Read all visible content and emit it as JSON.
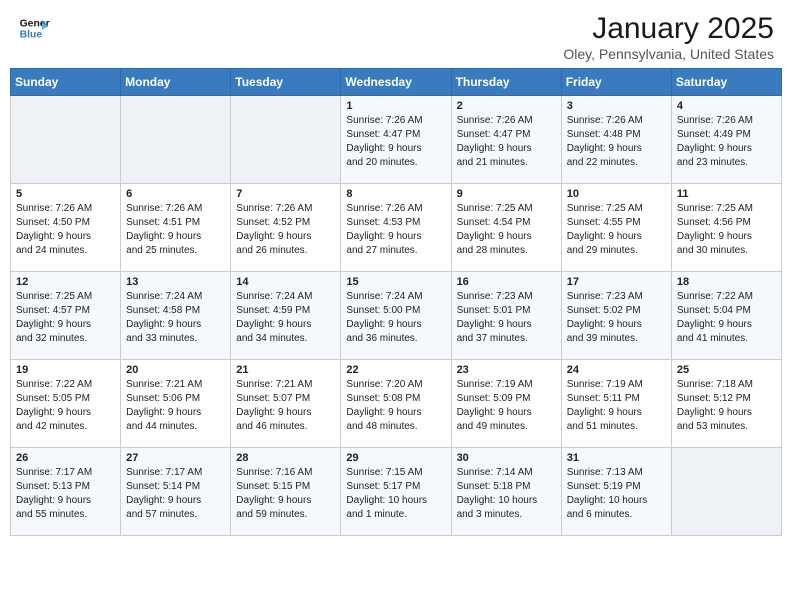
{
  "header": {
    "logo_line1": "General",
    "logo_line2": "Blue",
    "month": "January 2025",
    "location": "Oley, Pennsylvania, United States"
  },
  "weekdays": [
    "Sunday",
    "Monday",
    "Tuesday",
    "Wednesday",
    "Thursday",
    "Friday",
    "Saturday"
  ],
  "weeks": [
    [
      {
        "day": "",
        "info": ""
      },
      {
        "day": "",
        "info": ""
      },
      {
        "day": "",
        "info": ""
      },
      {
        "day": "1",
        "info": "Sunrise: 7:26 AM\nSunset: 4:47 PM\nDaylight: 9 hours\nand 20 minutes."
      },
      {
        "day": "2",
        "info": "Sunrise: 7:26 AM\nSunset: 4:47 PM\nDaylight: 9 hours\nand 21 minutes."
      },
      {
        "day": "3",
        "info": "Sunrise: 7:26 AM\nSunset: 4:48 PM\nDaylight: 9 hours\nand 22 minutes."
      },
      {
        "day": "4",
        "info": "Sunrise: 7:26 AM\nSunset: 4:49 PM\nDaylight: 9 hours\nand 23 minutes."
      }
    ],
    [
      {
        "day": "5",
        "info": "Sunrise: 7:26 AM\nSunset: 4:50 PM\nDaylight: 9 hours\nand 24 minutes."
      },
      {
        "day": "6",
        "info": "Sunrise: 7:26 AM\nSunset: 4:51 PM\nDaylight: 9 hours\nand 25 minutes."
      },
      {
        "day": "7",
        "info": "Sunrise: 7:26 AM\nSunset: 4:52 PM\nDaylight: 9 hours\nand 26 minutes."
      },
      {
        "day": "8",
        "info": "Sunrise: 7:26 AM\nSunset: 4:53 PM\nDaylight: 9 hours\nand 27 minutes."
      },
      {
        "day": "9",
        "info": "Sunrise: 7:25 AM\nSunset: 4:54 PM\nDaylight: 9 hours\nand 28 minutes."
      },
      {
        "day": "10",
        "info": "Sunrise: 7:25 AM\nSunset: 4:55 PM\nDaylight: 9 hours\nand 29 minutes."
      },
      {
        "day": "11",
        "info": "Sunrise: 7:25 AM\nSunset: 4:56 PM\nDaylight: 9 hours\nand 30 minutes."
      }
    ],
    [
      {
        "day": "12",
        "info": "Sunrise: 7:25 AM\nSunset: 4:57 PM\nDaylight: 9 hours\nand 32 minutes."
      },
      {
        "day": "13",
        "info": "Sunrise: 7:24 AM\nSunset: 4:58 PM\nDaylight: 9 hours\nand 33 minutes."
      },
      {
        "day": "14",
        "info": "Sunrise: 7:24 AM\nSunset: 4:59 PM\nDaylight: 9 hours\nand 34 minutes."
      },
      {
        "day": "15",
        "info": "Sunrise: 7:24 AM\nSunset: 5:00 PM\nDaylight: 9 hours\nand 36 minutes."
      },
      {
        "day": "16",
        "info": "Sunrise: 7:23 AM\nSunset: 5:01 PM\nDaylight: 9 hours\nand 37 minutes."
      },
      {
        "day": "17",
        "info": "Sunrise: 7:23 AM\nSunset: 5:02 PM\nDaylight: 9 hours\nand 39 minutes."
      },
      {
        "day": "18",
        "info": "Sunrise: 7:22 AM\nSunset: 5:04 PM\nDaylight: 9 hours\nand 41 minutes."
      }
    ],
    [
      {
        "day": "19",
        "info": "Sunrise: 7:22 AM\nSunset: 5:05 PM\nDaylight: 9 hours\nand 42 minutes."
      },
      {
        "day": "20",
        "info": "Sunrise: 7:21 AM\nSunset: 5:06 PM\nDaylight: 9 hours\nand 44 minutes."
      },
      {
        "day": "21",
        "info": "Sunrise: 7:21 AM\nSunset: 5:07 PM\nDaylight: 9 hours\nand 46 minutes."
      },
      {
        "day": "22",
        "info": "Sunrise: 7:20 AM\nSunset: 5:08 PM\nDaylight: 9 hours\nand 48 minutes."
      },
      {
        "day": "23",
        "info": "Sunrise: 7:19 AM\nSunset: 5:09 PM\nDaylight: 9 hours\nand 49 minutes."
      },
      {
        "day": "24",
        "info": "Sunrise: 7:19 AM\nSunset: 5:11 PM\nDaylight: 9 hours\nand 51 minutes."
      },
      {
        "day": "25",
        "info": "Sunrise: 7:18 AM\nSunset: 5:12 PM\nDaylight: 9 hours\nand 53 minutes."
      }
    ],
    [
      {
        "day": "26",
        "info": "Sunrise: 7:17 AM\nSunset: 5:13 PM\nDaylight: 9 hours\nand 55 minutes."
      },
      {
        "day": "27",
        "info": "Sunrise: 7:17 AM\nSunset: 5:14 PM\nDaylight: 9 hours\nand 57 minutes."
      },
      {
        "day": "28",
        "info": "Sunrise: 7:16 AM\nSunset: 5:15 PM\nDaylight: 9 hours\nand 59 minutes."
      },
      {
        "day": "29",
        "info": "Sunrise: 7:15 AM\nSunset: 5:17 PM\nDaylight: 10 hours\nand 1 minute."
      },
      {
        "day": "30",
        "info": "Sunrise: 7:14 AM\nSunset: 5:18 PM\nDaylight: 10 hours\nand 3 minutes."
      },
      {
        "day": "31",
        "info": "Sunrise: 7:13 AM\nSunset: 5:19 PM\nDaylight: 10 hours\nand 6 minutes."
      },
      {
        "day": "",
        "info": ""
      }
    ]
  ]
}
